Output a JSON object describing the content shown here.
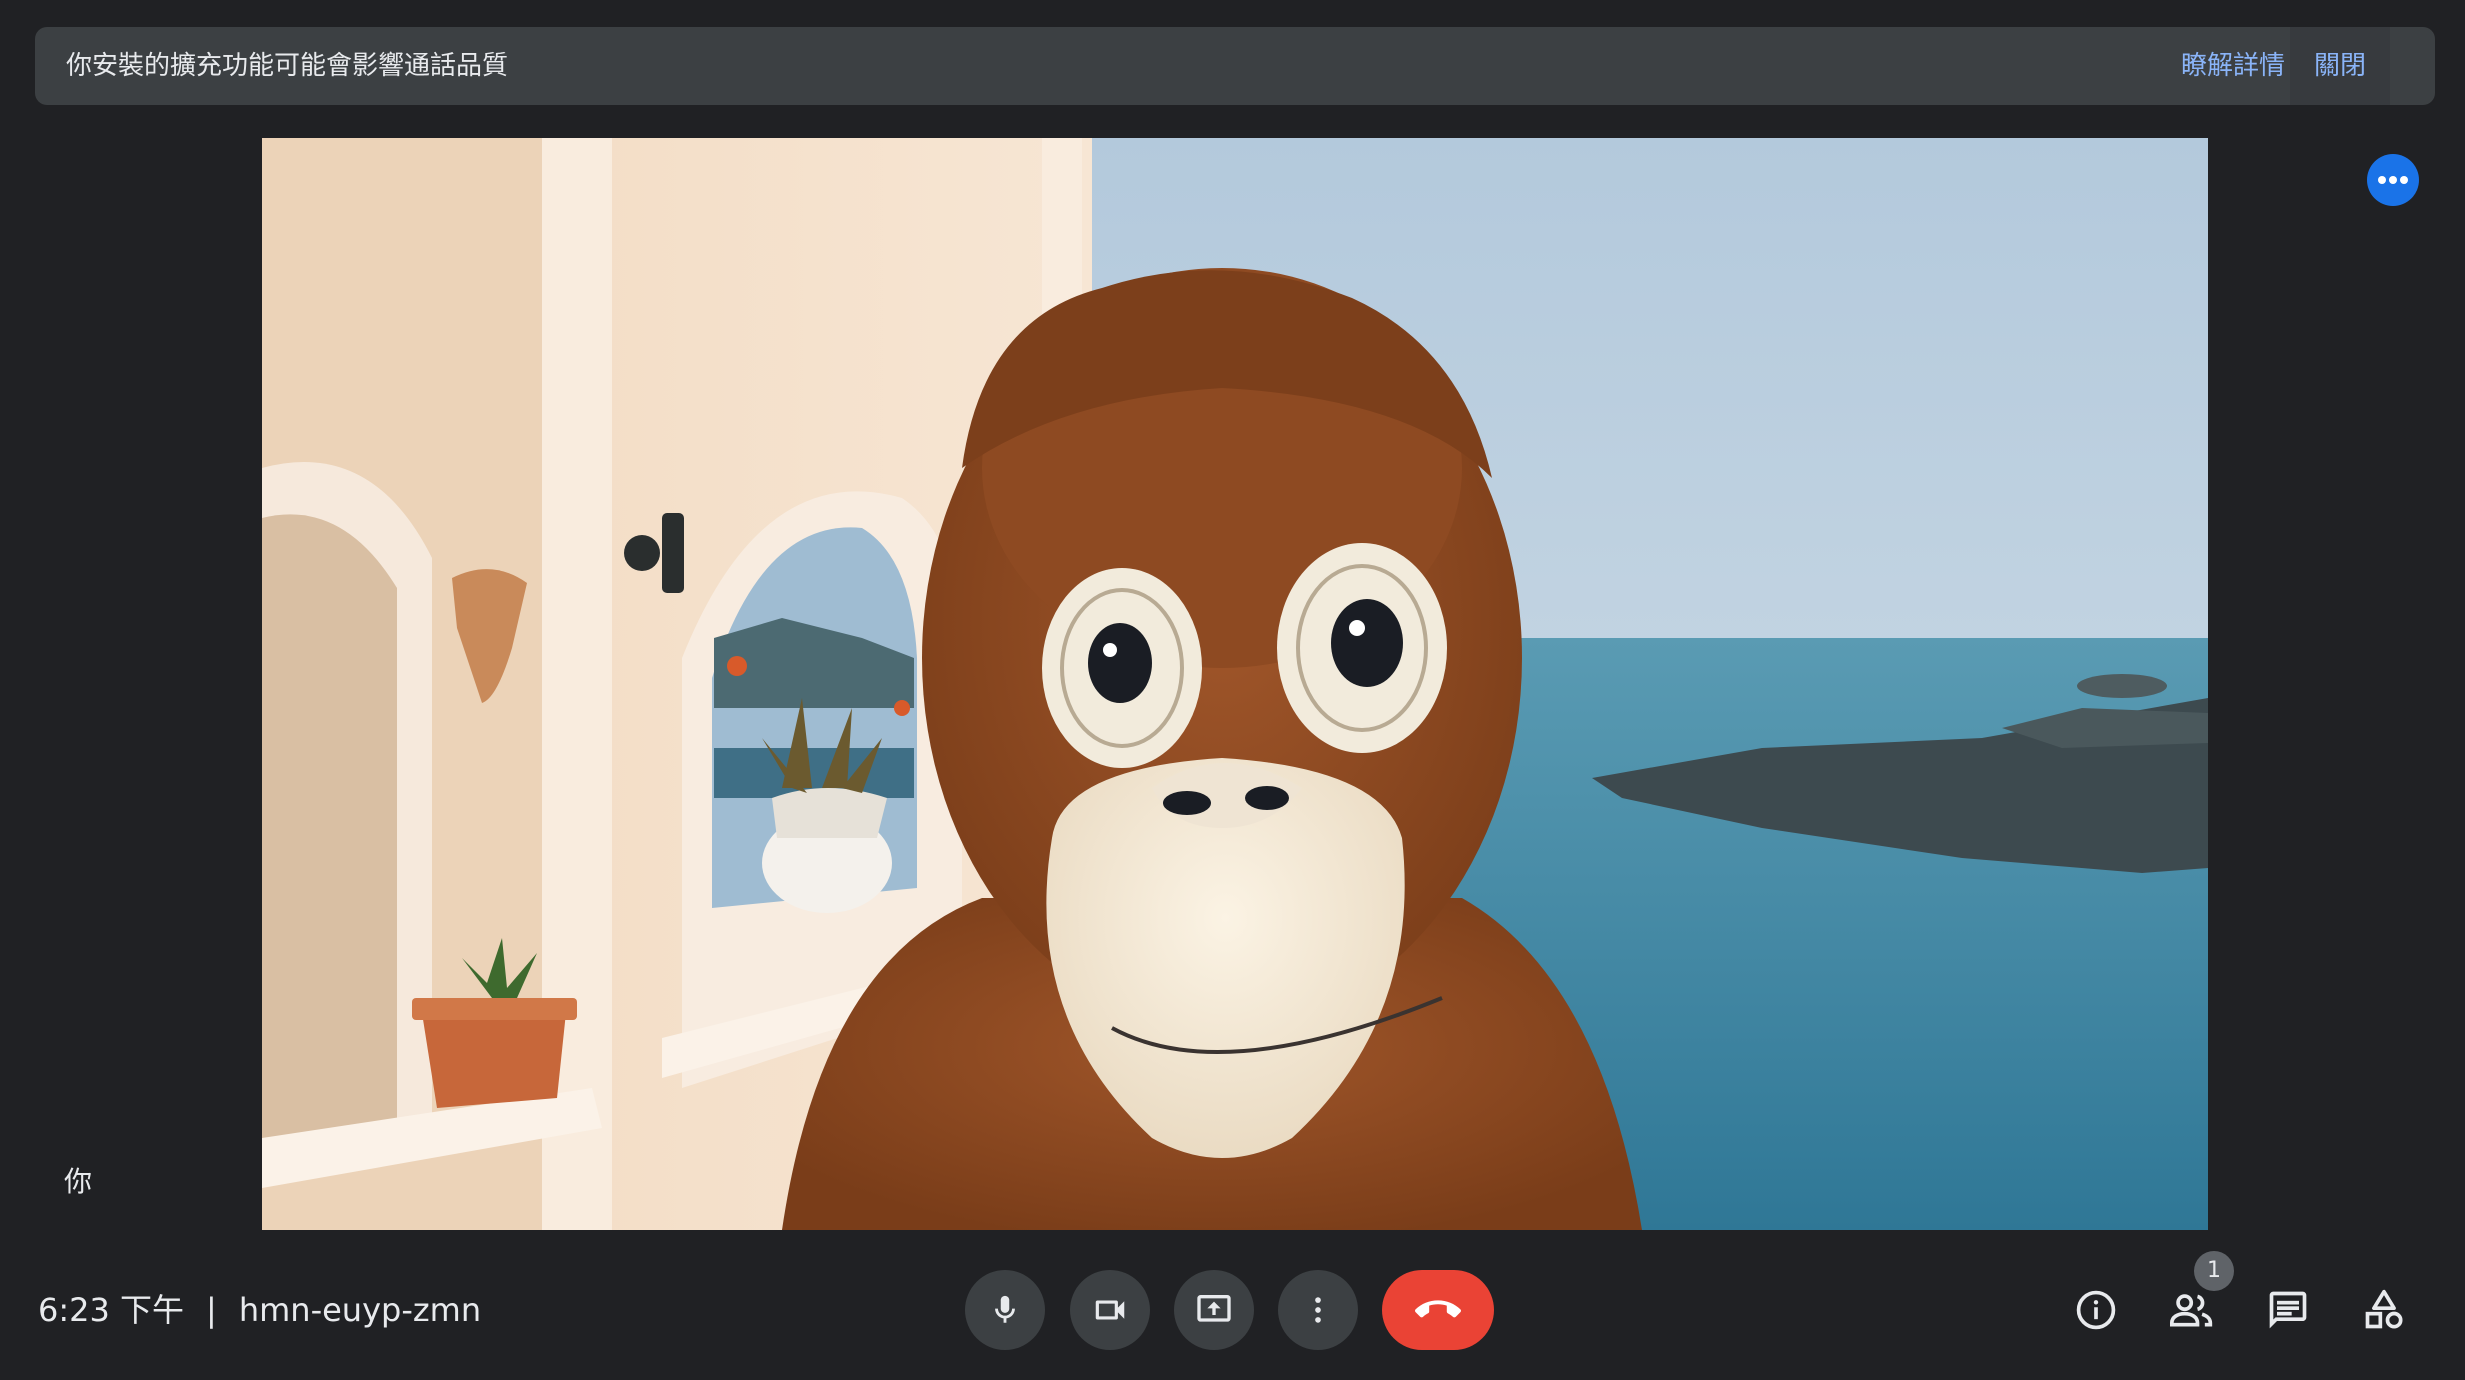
{
  "banner": {
    "message": "你安裝的擴充功能可能會影響通話品質",
    "learn_more": "瞭解詳情",
    "close": "關閉"
  },
  "video": {
    "participant_label": "你"
  },
  "footer": {
    "time": "6:23 下午",
    "separator": "|",
    "meeting_code": "hmn-euyp-zmn",
    "people_count": "1"
  },
  "controls": {
    "mic_icon": "mic-icon",
    "camera_icon": "videocam-icon",
    "present_icon": "present-screen-icon",
    "more_icon": "more-vert-icon",
    "hangup_icon": "call-end-icon"
  },
  "side": {
    "info_icon": "info-icon",
    "people_icon": "people-icon",
    "chat_icon": "chat-icon",
    "activities_icon": "activities-icon"
  },
  "colors": {
    "background": "#202124",
    "banner": "#3c4043",
    "link": "#8ab4f8",
    "accent": "#1a73e8",
    "hangup": "#ea4335"
  }
}
